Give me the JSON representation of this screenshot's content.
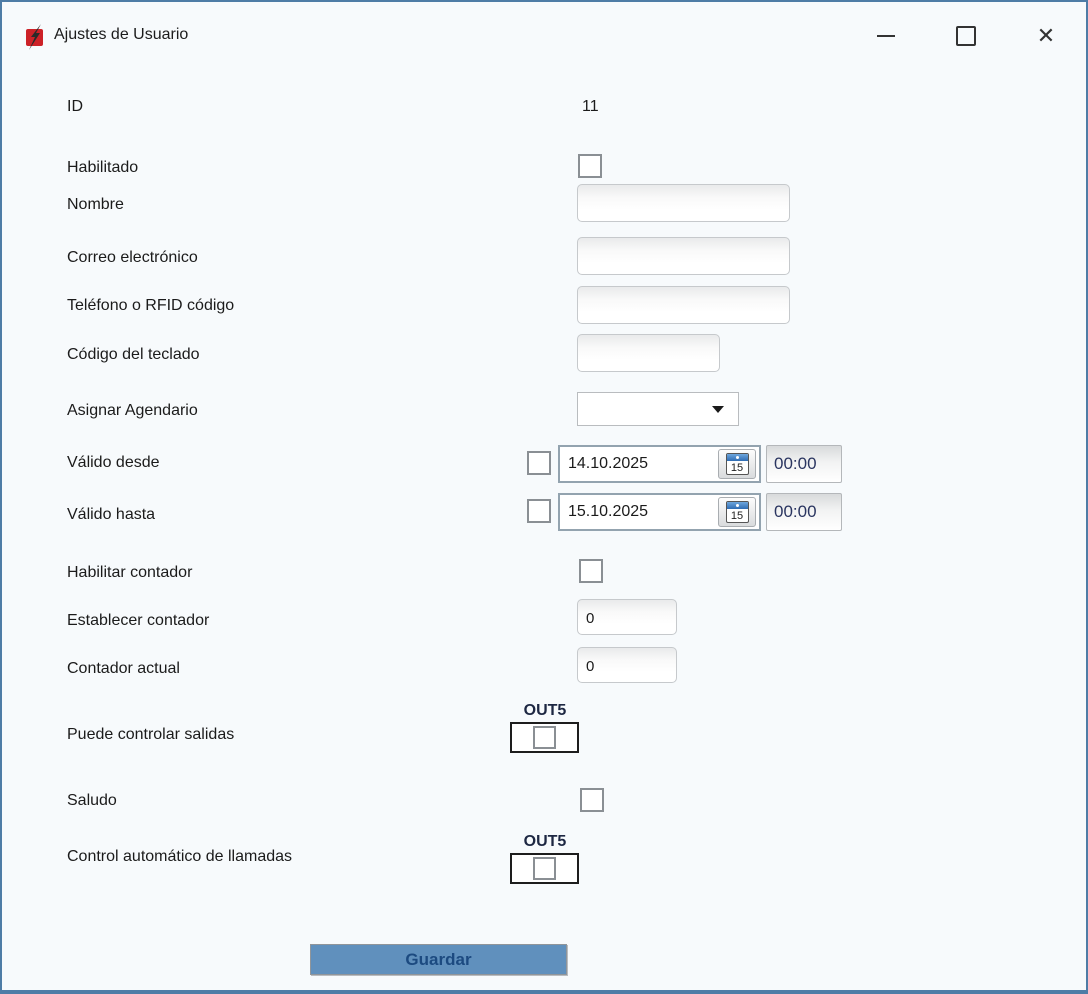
{
  "window": {
    "title": "Ajustes de Usuario"
  },
  "colors": {
    "window_border": "#4e7ca6",
    "button_blue": "#6090bd",
    "button_text": "#1c4a80",
    "app_icon_red": "#cc2127"
  },
  "form": {
    "id": {
      "label": "ID",
      "value": "11"
    },
    "habilitado": {
      "label": "Habilitado",
      "checked": false
    },
    "nombre": {
      "label": "Nombre",
      "value": ""
    },
    "correo": {
      "label": "Correo electrónico",
      "value": ""
    },
    "telefono": {
      "label": "Teléfono o RFID código",
      "value": ""
    },
    "codigo_teclado": {
      "label": "Código del teclado",
      "value": ""
    },
    "agendario": {
      "label": "Asignar Agendario",
      "selected": ""
    },
    "valido_desde": {
      "label": "Válido desde",
      "checked": false,
      "date": "14.10.2025",
      "time": "00:00",
      "calendar_day": "15"
    },
    "valido_hasta": {
      "label": "Válido hasta",
      "checked": false,
      "date": "15.10.2025",
      "time": "00:00",
      "calendar_day": "15"
    },
    "habilitar_contador": {
      "label": "Habilitar contador",
      "checked": false
    },
    "establecer_contador": {
      "label": "Establecer contador",
      "value": "0"
    },
    "contador_actual": {
      "label": "Contador actual",
      "value": "0"
    },
    "puede_controlar_salidas": {
      "label": "Puede controlar salidas",
      "output_label": "OUT5",
      "checked": false
    },
    "saludo": {
      "label": "Saludo",
      "checked": false
    },
    "control_automatico": {
      "label": "Control automático de llamadas",
      "output_label": "OUT5",
      "checked": false
    }
  },
  "buttons": {
    "save": "Guardar"
  }
}
